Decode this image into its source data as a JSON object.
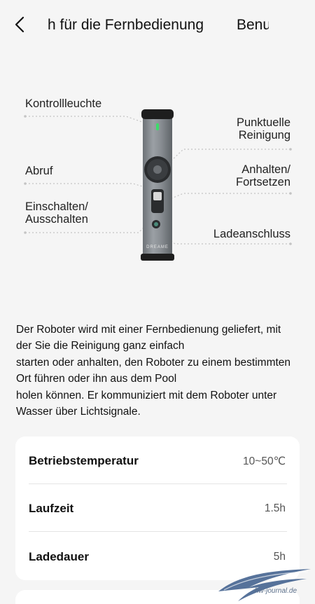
{
  "header": {
    "tab_1": "h für die Fernbedienung",
    "tab_2": "Benu"
  },
  "diagram": {
    "labels": {
      "indicator_light": "Kontrollleuchte",
      "recall": "Abruf",
      "power": [
        "Einschalten/",
        "Ausschalten"
      ],
      "spot_cleaning": [
        "Punktuelle",
        "Reinigung"
      ],
      "pause_resume": [
        "Anhalten/",
        "Fortsetzen"
      ],
      "charging_port": "Ladeanschluss"
    },
    "device_brand": "DREAME"
  },
  "description": [
    "Der Roboter wird mit einer Fernbedienung geliefert, mit",
    "der Sie die Reinigung ganz einfach",
    "starten oder anhalten, den Roboter zu einem bestimmten",
    "Ort führen oder ihn aus dem Pool",
    "holen können. Er kommuniziert mit dem Roboter unter",
    "Wasser über Lichtsignale."
  ],
  "specs": [
    {
      "label": "Betriebstemperatur",
      "value": "10~50℃"
    },
    {
      "label": "Laufzeit",
      "value": "1.5h"
    },
    {
      "label": "Ladedauer",
      "value": "5h"
    }
  ],
  "watermark": "hw-journal.de",
  "colors": {
    "background": "#f5f5f5",
    "card": "#ffffff",
    "device_body": "#8a8f94",
    "indicator": "#3ddc6a"
  }
}
